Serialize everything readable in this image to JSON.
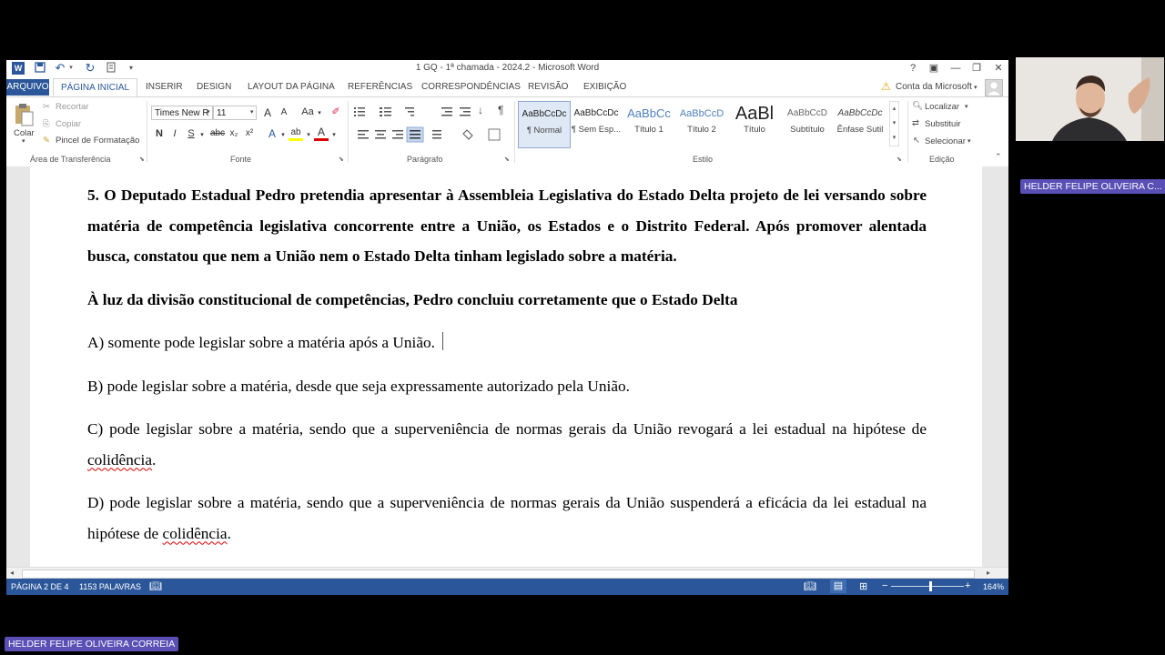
{
  "window": {
    "title": "1 GQ - 1ª chamada - 2024.2 - Microsoft Word",
    "help": "?",
    "ribbon_opts": "▣",
    "minimize": "—",
    "maximize": "❐",
    "close": "✕"
  },
  "quick_access": {
    "undo": "↶",
    "redo": "↻",
    "customize": "▾"
  },
  "tabs": {
    "file": "ARQUIVO",
    "home": "PÁGINA INICIAL",
    "insert": "INSERIR",
    "design": "DESIGN",
    "layout": "LAYOUT DA PÁGINA",
    "references": "REFERÊNCIAS",
    "mailings": "CORRESPONDÊNCIAS",
    "review": "REVISÃO",
    "view": "EXIBIÇÃO",
    "account": "Conta da Microsoft"
  },
  "ribbon": {
    "clipboard": {
      "paste": "Colar",
      "cut": "Recortar",
      "copy": "Copiar",
      "format_painter": "Pincel de Formatação",
      "label": "Área de Transferência"
    },
    "font": {
      "font_name": "Times New R",
      "font_size": "11",
      "grow": "A",
      "shrink": "A",
      "case": "Aa",
      "bold": "N",
      "italic": "I",
      "underline": "S",
      "strike": "abc",
      "subscript": "x₂",
      "superscript": "x²",
      "text_effects": "A",
      "highlight": "ab",
      "font_color": "A",
      "label": "Fonte"
    },
    "paragraph": {
      "pilcrow": "¶",
      "sort": "↓",
      "label": "Parágrafo"
    },
    "styles": {
      "label": "Estilo",
      "items": [
        {
          "preview": "AaBbCcDc",
          "name": "¶ Normal"
        },
        {
          "preview": "AaBbCcDc",
          "name": "¶ Sem Esp..."
        },
        {
          "preview": "AaBbCc",
          "name": "Título 1"
        },
        {
          "preview": "AaBbCcD",
          "name": "Título 2"
        },
        {
          "preview": "AaBl",
          "name": "Título"
        },
        {
          "preview": "AaBbCcD",
          "name": "Subtítulo"
        },
        {
          "preview": "AaBbCcDc",
          "name": "Ênfase Sutil"
        }
      ]
    },
    "editing": {
      "find": "Localizar",
      "replace": "Substituir",
      "select": "Selecionar",
      "label": "Edição"
    }
  },
  "document": {
    "question": "5. O Deputado Estadual Pedro pretendia apresentar à Assembleia Legislativa do Estado Delta projeto de lei versando sobre matéria de competência legislativa concorrente entre a União, os Estados e o Distrito Federal. Após promover alentada busca, constatou que nem a União nem o Estado Delta tinham legislado sobre a matéria.",
    "prompt": "À luz da divisão constitucional de competências, Pedro concluiu corretamente que o Estado Delta",
    "option_a": "A) somente pode legislar sobre a matéria após a União.",
    "option_b": "B) pode legislar sobre a matéria, desde que seja expressamente autorizado pela União.",
    "option_c_main": "C) pode legislar sobre a matéria, sendo que a superveniência de normas gerais da União revogará a lei estadual na hipótese de ",
    "option_c_end": ".",
    "option_d_main": "D) pode legislar sobre a matéria, sendo que a superveniência de normas gerais da União suspenderá a eficácia da lei estadual na hipótese de ",
    "option_d_end": ".",
    "misspelled_word": "colidência"
  },
  "statusbar": {
    "page": "PÁGINA 2 DE 4",
    "words": "1153 PALAVRAS",
    "zoom": "164%",
    "zoom_minus": "−",
    "zoom_plus": "+"
  },
  "participants": {
    "webcam_name": "HELDER FELIPE OLIVEIRA C...",
    "presenter_name": "HELDER FELIPE OLIVEIRA CORREIA"
  },
  "colors": {
    "accent": "#2b579a",
    "badge": "#5a4fb5",
    "spell_error": "#dd0000"
  }
}
